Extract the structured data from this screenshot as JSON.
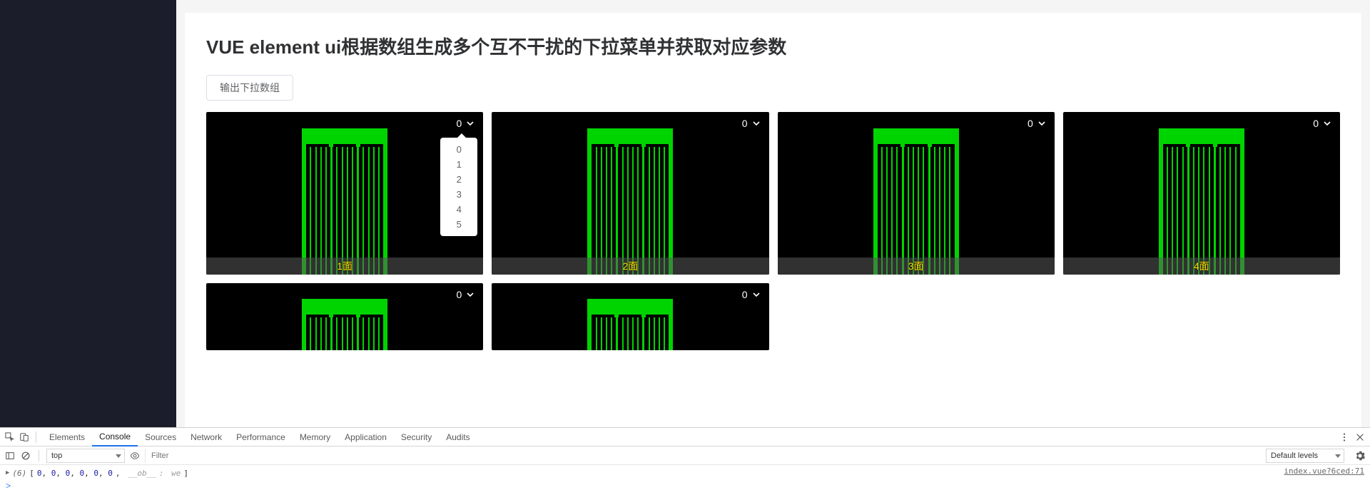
{
  "page": {
    "title": "VUE element ui根据数组生成多个互不干扰的下拉菜单并获取对应参数",
    "output_btn_label": "输出下拉数组"
  },
  "dropdown": {
    "options": [
      "0",
      "1",
      "2",
      "3",
      "4",
      "5"
    ]
  },
  "tiles": [
    {
      "selected": "0",
      "footer": "1面",
      "open": true,
      "short": false
    },
    {
      "selected": "0",
      "footer": "2面",
      "open": false,
      "short": false
    },
    {
      "selected": "0",
      "footer": "3面",
      "open": false,
      "short": false
    },
    {
      "selected": "0",
      "footer": "4面",
      "open": false,
      "short": false
    },
    {
      "selected": "0",
      "footer": "",
      "open": false,
      "short": true
    },
    {
      "selected": "0",
      "footer": "",
      "open": false,
      "short": true
    }
  ],
  "devtools": {
    "tabs": [
      "Elements",
      "Console",
      "Sources",
      "Network",
      "Performance",
      "Memory",
      "Application",
      "Security",
      "Audits"
    ],
    "active_tab": "Console",
    "context_select": "top",
    "filter_placeholder": "Filter",
    "levels_label": "Default levels",
    "log": {
      "prefix": "(6)",
      "values": [
        "0",
        "0",
        "0",
        "0",
        "0",
        "0"
      ],
      "observer_key": "__ob__",
      "observer_val": "we",
      "source": "index.vue?6ced:71"
    },
    "prompt": ">"
  }
}
